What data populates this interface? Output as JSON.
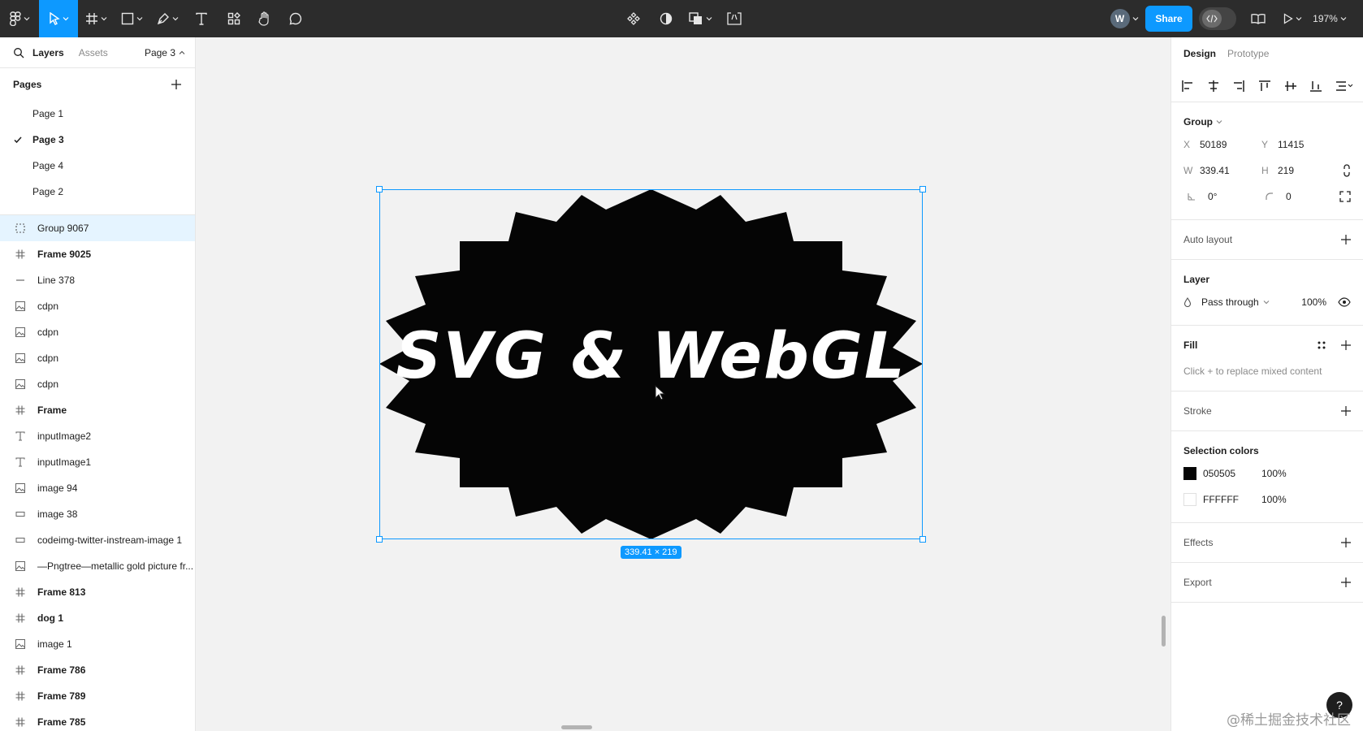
{
  "toolbar": {
    "avatar_initial": "W",
    "share_label": "Share",
    "zoom": "197%"
  },
  "left_panel": {
    "tabs": [
      "Layers",
      "Assets"
    ],
    "current_page": "Page 3",
    "pages_title": "Pages",
    "pages": [
      "Page 1",
      "Page 3",
      "Page 4",
      "Page 2"
    ],
    "layers": [
      {
        "name": "Group 9067",
        "icon": "group-icon"
      },
      {
        "name": "Frame 9025",
        "icon": "frame-icon"
      },
      {
        "name": "Line 378",
        "icon": "line-icon"
      },
      {
        "name": "cdpn",
        "icon": "image-icon"
      },
      {
        "name": "cdpn",
        "icon": "image-icon"
      },
      {
        "name": "cdpn",
        "icon": "image-icon"
      },
      {
        "name": "cdpn",
        "icon": "image-icon"
      },
      {
        "name": "Frame",
        "icon": "frame-icon"
      },
      {
        "name": "inputImage2",
        "icon": "text-icon"
      },
      {
        "name": "inputImage1",
        "icon": "text-icon"
      },
      {
        "name": "image 94",
        "icon": "image-icon"
      },
      {
        "name": "image 38",
        "icon": "rectangle-icon"
      },
      {
        "name": "codeimg-twitter-instream-image 1",
        "icon": "rectangle-icon"
      },
      {
        "name": "—Pngtree—metallic gold picture fr...",
        "icon": "image-icon"
      },
      {
        "name": "Frame 813",
        "icon": "frame-icon"
      },
      {
        "name": "dog 1",
        "icon": "frame-icon"
      },
      {
        "name": "image 1",
        "icon": "image-icon"
      },
      {
        "name": "Frame 786",
        "icon": "frame-icon"
      },
      {
        "name": "Frame 789",
        "icon": "frame-icon"
      },
      {
        "name": "Frame 785",
        "icon": "frame-icon"
      }
    ]
  },
  "canvas": {
    "artwork_text": "SVG & WebGL",
    "size_badge": "339.41 × 219"
  },
  "right_panel": {
    "tabs": [
      "Design",
      "Prototype"
    ],
    "group_label": "Group",
    "x": {
      "key": "X",
      "value": "50189"
    },
    "y": {
      "key": "Y",
      "value": "11415"
    },
    "w": {
      "key": "W",
      "value": "339.41"
    },
    "h": {
      "key": "H",
      "value": "219"
    },
    "rotation": "0°",
    "corner_radius": "0",
    "auto_layout": "Auto layout",
    "layer_title": "Layer",
    "blend_mode": "Pass through",
    "layer_opacity": "100%",
    "fill_title": "Fill",
    "fill_hint": "Click + to replace mixed content",
    "stroke_title": "Stroke",
    "selection_colors_title": "Selection colors",
    "selection_colors": [
      {
        "hex": "050505",
        "opacity": "100%",
        "swatch": "#050505"
      },
      {
        "hex": "FFFFFF",
        "opacity": "100%",
        "swatch": "#FFFFFF"
      }
    ],
    "effects_title": "Effects",
    "export_title": "Export"
  },
  "help": "?",
  "watermark": "@稀土掘金技术社区",
  "colors": {
    "accent": "#0d99ff",
    "toolbar_bg": "#2c2c2c",
    "canvas_bg": "#f2f2f2",
    "selected_layer_bg": "#e5f4ff"
  }
}
